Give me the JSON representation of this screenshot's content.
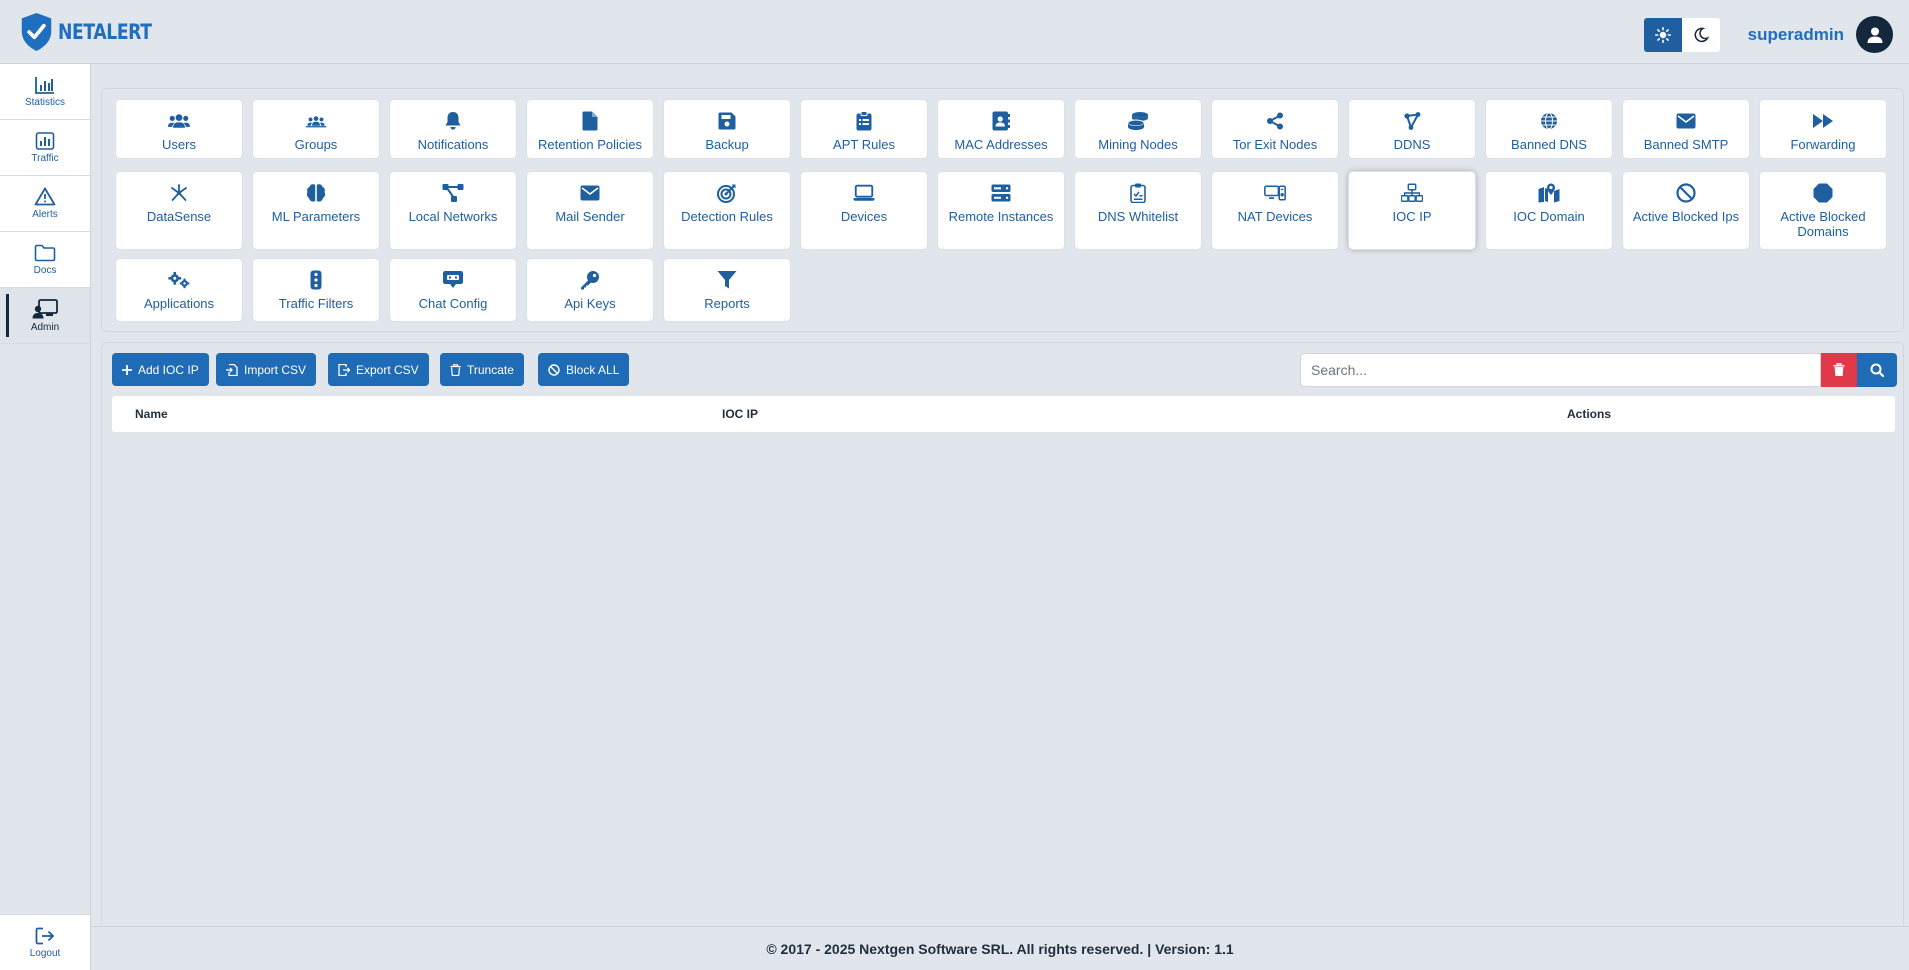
{
  "app": {
    "brand": "NETALERT"
  },
  "header": {
    "username": "superadmin"
  },
  "sidebar": {
    "items": [
      {
        "label": "Statistics"
      },
      {
        "label": "Traffic"
      },
      {
        "label": "Alerts"
      },
      {
        "label": "Docs"
      },
      {
        "label": "Admin"
      }
    ],
    "logout": "Logout"
  },
  "tiles": [
    {
      "label": "Users"
    },
    {
      "label": "Groups"
    },
    {
      "label": "Notifications"
    },
    {
      "label": "Retention Policies"
    },
    {
      "label": "Backup"
    },
    {
      "label": "APT Rules"
    },
    {
      "label": "MAC Addresses"
    },
    {
      "label": "Mining Nodes"
    },
    {
      "label": "Tor Exit Nodes"
    },
    {
      "label": "DDNS"
    },
    {
      "label": "Banned DNS"
    },
    {
      "label": "Banned SMTP"
    },
    {
      "label": "Forwarding"
    },
    {
      "label": "DataSense"
    },
    {
      "label": "ML Parameters"
    },
    {
      "label": "Local Networks"
    },
    {
      "label": "Mail Sender"
    },
    {
      "label": "Detection Rules"
    },
    {
      "label": "Devices"
    },
    {
      "label": "Remote Instances"
    },
    {
      "label": "DNS Whitelist"
    },
    {
      "label": "NAT Devices"
    },
    {
      "label": "IOC IP"
    },
    {
      "label": "IOC Domain"
    },
    {
      "label": "Active Blocked Ips"
    },
    {
      "label": "Active Blocked Domains"
    },
    {
      "label": "Applications"
    },
    {
      "label": "Traffic Filters"
    },
    {
      "label": "Chat Config"
    },
    {
      "label": "Api Keys"
    },
    {
      "label": "Reports"
    }
  ],
  "toolbar": {
    "add": "Add IOC IP",
    "import": "Import CSV",
    "export": "Export CSV",
    "truncate": "Truncate",
    "block_all": "Block ALL"
  },
  "search": {
    "placeholder": "Search...",
    "value": ""
  },
  "table": {
    "columns": [
      "Name",
      "IOC IP",
      "Actions"
    ]
  },
  "footer": {
    "text": "© 2017 - 2025 Nextgen Software SRL. All rights reserved. | Version: 1.1"
  },
  "colors": {
    "primary": "#1f6bb5",
    "danger": "#e03a4a",
    "background": "#e1e6ec",
    "dark": "#14273d"
  }
}
